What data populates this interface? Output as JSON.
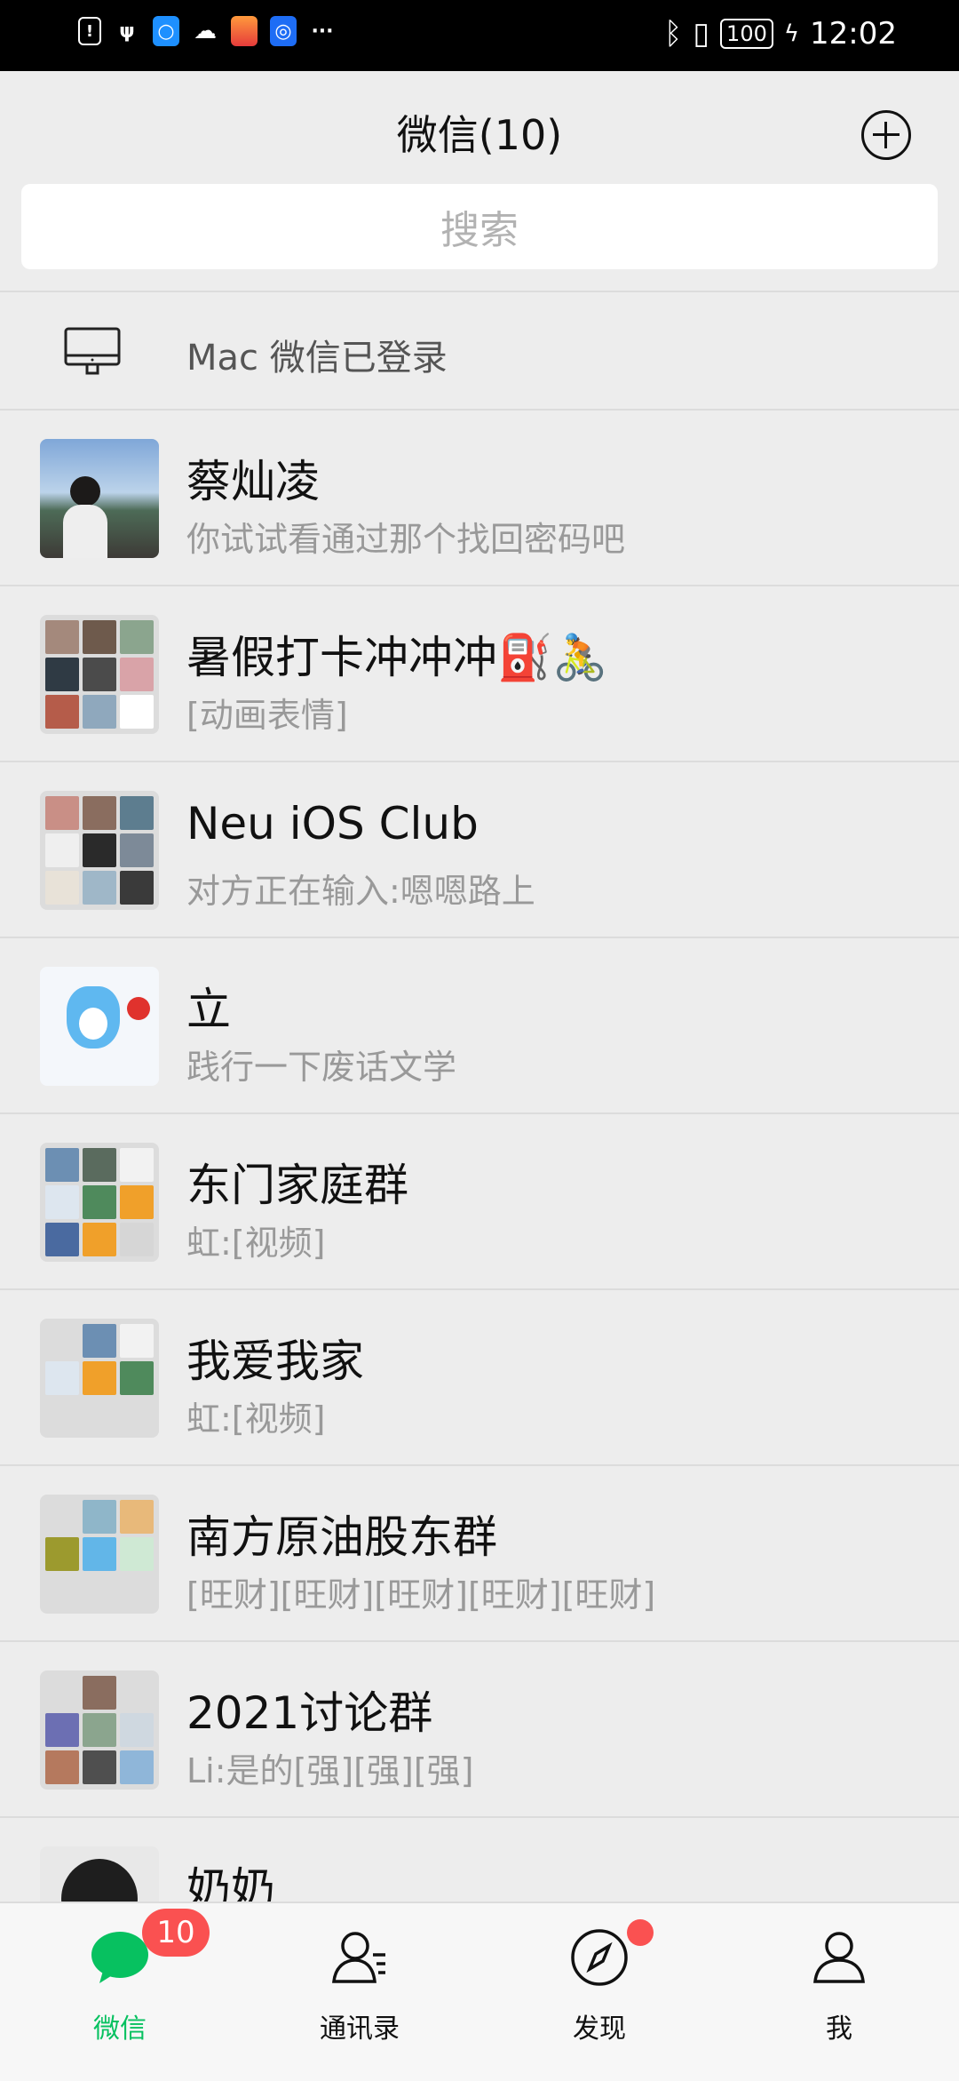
{
  "status_bar": {
    "time": "12:02",
    "battery": "100",
    "left_icons": [
      "notice-icon",
      "usb-icon",
      "search-app-icon",
      "cloud-icon",
      "app-icon",
      "bulb-icon",
      "more-icon"
    ]
  },
  "header": {
    "title": "微信(10)",
    "add_icon": "plus-circle-icon"
  },
  "search": {
    "placeholder": "搜索"
  },
  "mac_login": {
    "text": "Mac 微信已登录",
    "icon": "monitor-icon"
  },
  "chats": [
    {
      "name": "蔡灿凌",
      "preview": "你试试看通过那个找回密码吧"
    },
    {
      "name": "暑假打卡冲冲冲⛽🚴",
      "preview": "[动画表情]"
    },
    {
      "name": "Neu iOS Club",
      "preview": "对方正在输入:嗯嗯路上"
    },
    {
      "name": "立",
      "preview": "践行一下废话文学"
    },
    {
      "name": "东门家庭群",
      "preview": "虹:[视频]"
    },
    {
      "name": "我爱我家",
      "preview": "虹:[视频]"
    },
    {
      "name": "南方原油股东群",
      "preview": "[旺财][旺财][旺财][旺财][旺财]"
    },
    {
      "name": "2021讨论群",
      "preview": "Li:是的[强][强][强]"
    },
    {
      "name": "奶奶",
      "preview": ""
    }
  ],
  "tabs": [
    {
      "label": "微信",
      "icon": "chat-bubble-icon",
      "badge": "10",
      "active": true
    },
    {
      "label": "通讯录",
      "icon": "contacts-icon"
    },
    {
      "label": "发现",
      "icon": "compass-icon",
      "dot": true
    },
    {
      "label": "我",
      "icon": "person-icon"
    }
  ],
  "colors": {
    "accent": "#07c160",
    "badge": "#fa5151",
    "background": "#ededed"
  }
}
